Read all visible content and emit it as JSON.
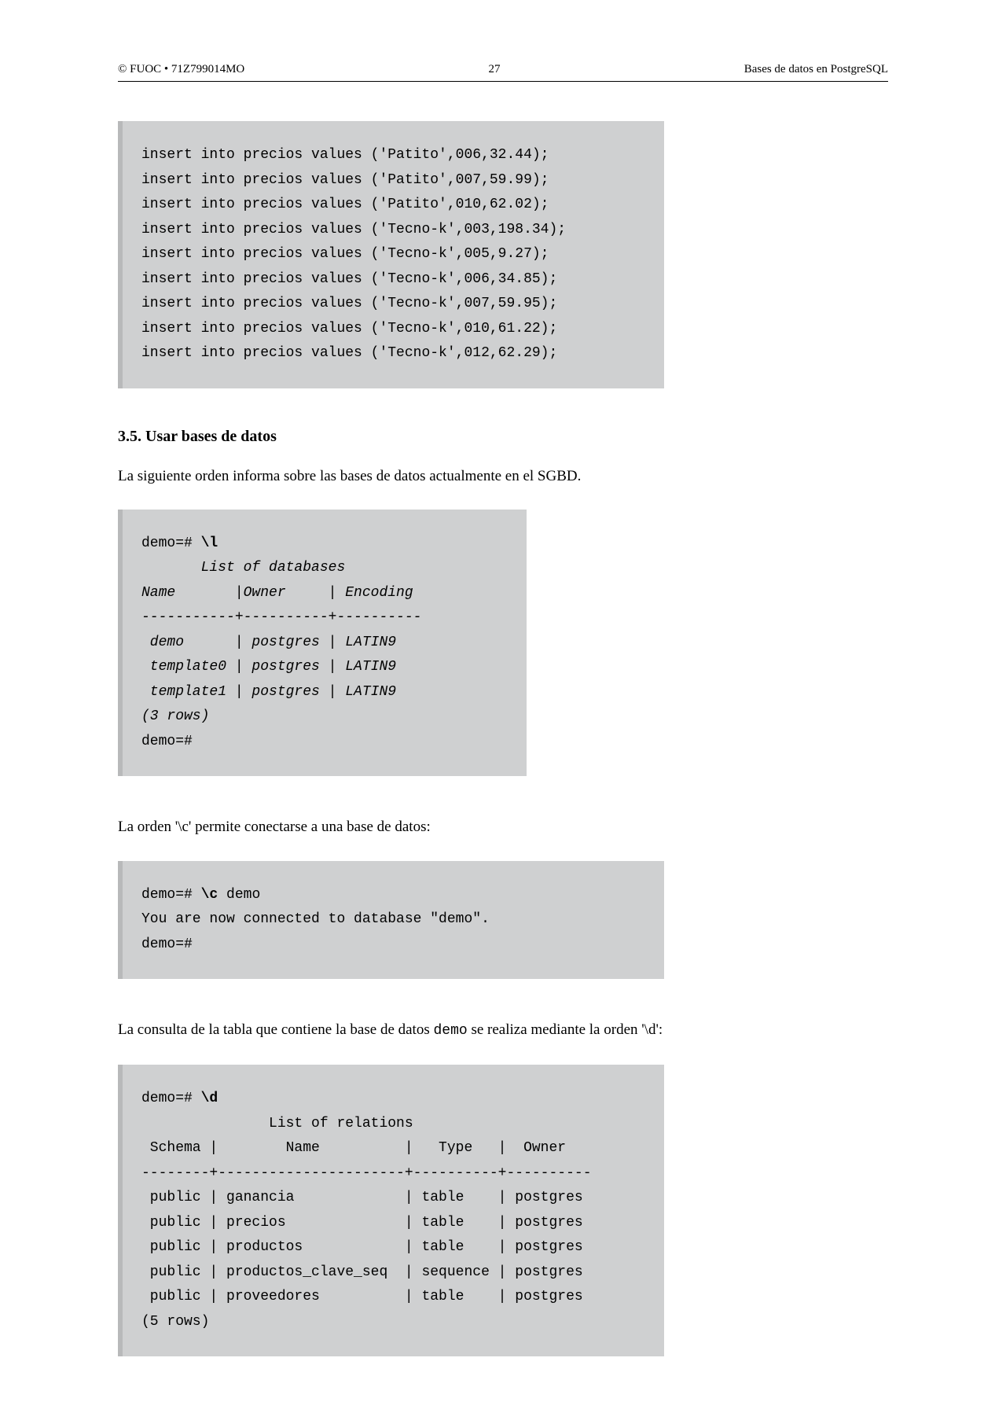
{
  "header": {
    "left": "© FUOC • 71Z799014MO",
    "center": "27",
    "right": "Bases de datos en PostgreSQL"
  },
  "code1": {
    "lines": [
      "insert into precios values ('Patito',006,32.44);",
      "insert into precios values ('Patito',007,59.99);",
      "insert into precios values ('Patito',010,62.02);",
      "insert into precios values ('Tecno-k',003,198.34);",
      "insert into precios values ('Tecno-k',005,9.27);",
      "insert into precios values ('Tecno-k',006,34.85);",
      "insert into precios values ('Tecno-k',007,59.95);",
      "insert into precios values ('Tecno-k',010,61.22);",
      "insert into precios values ('Tecno-k',012,62.29);"
    ]
  },
  "section": {
    "number": "3.5.",
    "title": "Usar bases de datos"
  },
  "para1": "La siguiente orden informa sobre las bases de datos actualmente en el SGBD.",
  "code2": {
    "prompt1": "demo=# ",
    "cmd1": "\\l",
    "out_lines": [
      "       List of databases",
      "Name       |Owner     | Encoding",
      "-----------+----------+----------",
      " demo      | postgres | LATIN9",
      " template0 | postgres | LATIN9",
      " template1 | postgres | LATIN9",
      "(3 rows)"
    ],
    "prompt2": "demo=#"
  },
  "para2": "La orden '\\c' permite conectarse a una base de datos:",
  "code3": {
    "prompt1": "demo=# ",
    "cmd1": "\\c",
    "cmd1_arg": " demo",
    "out1": "You are now connected to database \"demo\".",
    "prompt2": "demo=#"
  },
  "para3_a": "La consulta de la tabla que contiene la base de datos ",
  "para3_mono": "demo",
  "para3_b": " se realiza mediante la orden '\\d':",
  "code4": {
    "prompt1": "demo=# ",
    "cmd1": "\\d",
    "out_lines": [
      "               List of relations",
      " Schema |        Name          |   Type   |  Owner",
      "--------+----------------------+----------+----------",
      " public | ganancia             | table    | postgres",
      " public | precios              | table    | postgres",
      " public | productos            | table    | postgres",
      " public | productos_clave_seq  | sequence | postgres",
      " public | proveedores          | table    | postgres",
      "(5 rows)"
    ]
  }
}
